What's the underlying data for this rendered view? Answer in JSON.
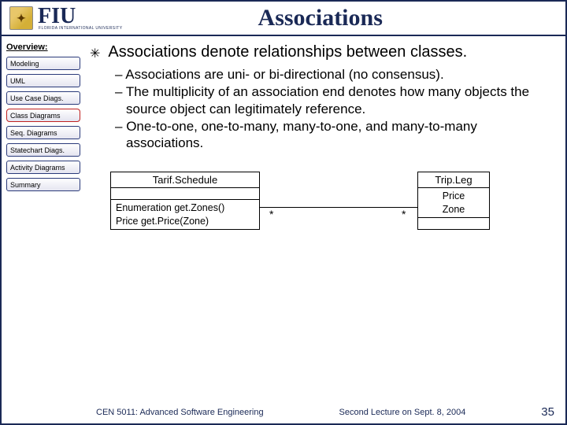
{
  "header": {
    "logo_glyph": "✦",
    "org_abbrev": "FIU",
    "org_full": "FLORIDA INTERNATIONAL UNIVERSITY",
    "title": "Associations"
  },
  "sidebar": {
    "label": "Overview:",
    "items": [
      {
        "label": "Modeling",
        "active": false
      },
      {
        "label": "UML",
        "active": false
      },
      {
        "label": "Use Case Diags.",
        "active": false
      },
      {
        "label": "Class Diagrams",
        "active": true
      },
      {
        "label": "Seq. Diagrams",
        "active": false
      },
      {
        "label": "Statechart Diags.",
        "active": false
      },
      {
        "label": "Activity Diagrams",
        "active": false
      },
      {
        "label": "Summary",
        "active": false
      }
    ]
  },
  "content": {
    "main_bullet": "Associations denote relationships between classes.",
    "sub_bullets": [
      "Associations are uni- or bi-directional (no consensus).",
      "The multiplicity of an association end denotes how many objects the source object can legitimately reference.",
      "One-to-one, one-to-many, many-to-one, and many-to-many associations."
    ]
  },
  "diagram": {
    "box1": {
      "name": "Tarif.Schedule",
      "method1": "Enumeration get.Zones()",
      "method2": "Price get.Price(Zone)"
    },
    "box2": {
      "name": "Trip.Leg",
      "attr1": "Price",
      "attr2": "Zone"
    },
    "mult_left": "*",
    "mult_right": "*"
  },
  "footer": {
    "left": "CEN 5011: Advanced Software Engineering",
    "right": "Second Lecture on Sept. 8, 2004",
    "page": "35"
  }
}
